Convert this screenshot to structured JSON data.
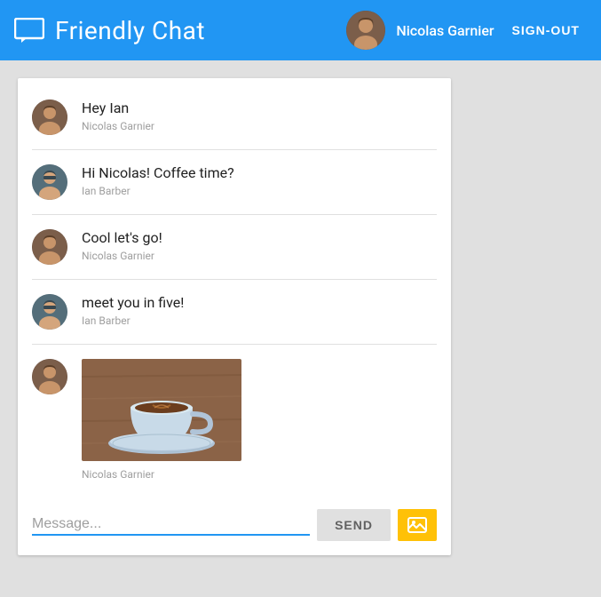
{
  "header": {
    "title": "Friendly Chat",
    "logo_icon": "chat-bubble",
    "user": {
      "name": "Nicolas Garnier",
      "avatar_alt": "Nicolas Garnier avatar"
    },
    "sign_out_label": "SIGN-OUT"
  },
  "messages": [
    {
      "id": 1,
      "text": "Hey Ian",
      "sender": "Nicolas Garnier",
      "avatar": "nicolas",
      "type": "text"
    },
    {
      "id": 2,
      "text": "Hi Nicolas! Coffee time?",
      "sender": "Ian Barber",
      "avatar": "ian",
      "type": "text"
    },
    {
      "id": 3,
      "text": "Cool let's go!",
      "sender": "Nicolas Garnier",
      "avatar": "nicolas",
      "type": "text"
    },
    {
      "id": 4,
      "text": "meet you in five!",
      "sender": "Ian Barber",
      "avatar": "ian",
      "type": "text"
    },
    {
      "id": 5,
      "text": "",
      "sender": "Nicolas Garnier",
      "avatar": "nicolas",
      "type": "image"
    }
  ],
  "input": {
    "placeholder": "Message...",
    "send_label": "SEND",
    "image_upload_label": "Upload image"
  }
}
